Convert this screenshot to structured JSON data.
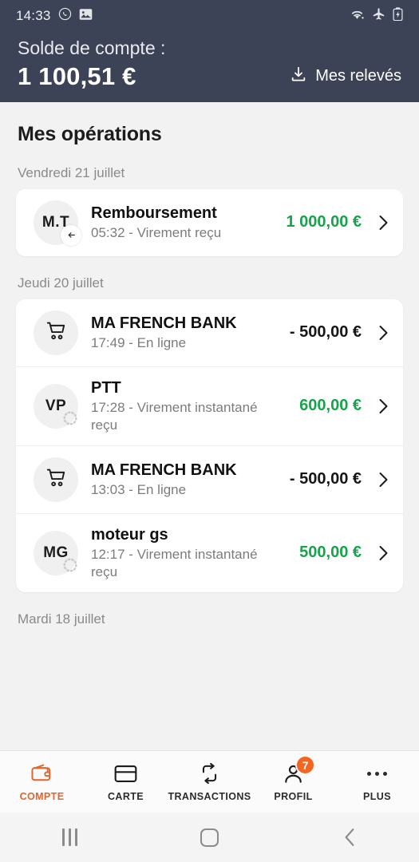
{
  "status_bar": {
    "time": "14:33",
    "left_icons": [
      "whatsapp-icon",
      "photo-icon"
    ],
    "right_icons": [
      "wifi-icon",
      "airplane-mode-icon",
      "battery-charging-icon"
    ]
  },
  "header": {
    "balance_label": "Solde de compte :",
    "balance_amount": "1 100,51 €",
    "statements_label": "Mes relevés",
    "statements_icon": "download-icon",
    "background_color": "#3D4356"
  },
  "main": {
    "title": "Mes opérations",
    "groups": [
      {
        "date": "Vendredi 21 juillet",
        "transactions": [
          {
            "avatar_type": "initials",
            "initials": "M.T",
            "badge": "arrow-left-badge",
            "title": "Remboursement",
            "subtitle": "05:32 - Virement reçu",
            "amount": "1 000,00 €",
            "amount_sign": "positive"
          }
        ]
      },
      {
        "date": "Jeudi 20 juillet",
        "transactions": [
          {
            "avatar_type": "icon",
            "icon": "shopping-cart-icon",
            "title": "MA FRENCH BANK",
            "subtitle": "17:49 - En ligne",
            "amount": "- 500,00 €",
            "amount_sign": "negative"
          },
          {
            "avatar_type": "initials",
            "initials": "VP",
            "badge": "dotted-circle-badge",
            "title": "PTT",
            "subtitle": "17:28 - Virement instantané reçu",
            "amount": "600,00 €",
            "amount_sign": "positive"
          },
          {
            "avatar_type": "icon",
            "icon": "shopping-cart-icon",
            "title": "MA FRENCH BANK",
            "subtitle": "13:03 - En ligne",
            "amount": "- 500,00 €",
            "amount_sign": "negative"
          },
          {
            "avatar_type": "initials",
            "initials": "MG",
            "badge": "dotted-circle-badge",
            "title": "moteur gs",
            "subtitle": "12:17 - Virement instantané reçu",
            "amount": "500,00 €",
            "amount_sign": "positive"
          }
        ]
      },
      {
        "date": "Mardi 18 juillet",
        "transactions": []
      }
    ]
  },
  "bottom_nav": {
    "active_color": "#E2652B",
    "badge_color": "#F26522",
    "items": [
      {
        "label": "COMPTE",
        "icon": "wallet-icon",
        "active": true,
        "badge": ""
      },
      {
        "label": "CARTE",
        "icon": "credit-card-icon",
        "active": false,
        "badge": ""
      },
      {
        "label": "TRANSACTIONS",
        "icon": "exchange-arrows-icon",
        "active": false,
        "badge": ""
      },
      {
        "label": "PROFIL",
        "icon": "person-icon",
        "active": false,
        "badge": "7"
      },
      {
        "label": "PLUS",
        "icon": "more-horizontal-icon",
        "active": false,
        "badge": ""
      }
    ]
  },
  "android_nav": {
    "recents": "recents-icon",
    "home": "home-icon",
    "back": "back-icon"
  }
}
